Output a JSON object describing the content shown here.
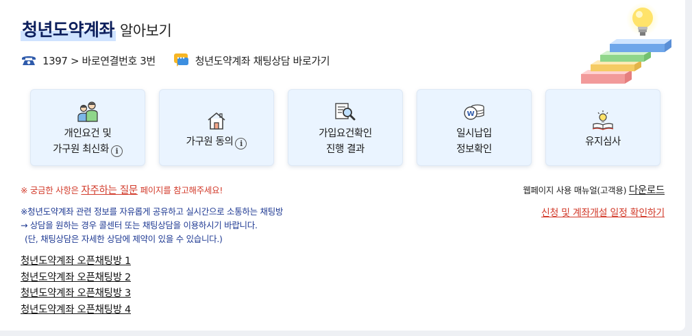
{
  "header": {
    "title_main": "청년도약계좌",
    "title_sub": "알아보기"
  },
  "contact": {
    "phone_text": "1397 > 바로연결번호 3번",
    "chat_text": "청년도약계좌 채팅상담 바로가기",
    "phone_icon": "phone-icon",
    "chat_icon": "chat-bubble-icon"
  },
  "cards": [
    {
      "line1": "개인요건 및",
      "line2": "가구원 최신화",
      "icon": "family-icon",
      "info": "i"
    },
    {
      "line1": "가구원 동의",
      "line2": "",
      "icon": "house-icon",
      "info": "i"
    },
    {
      "line1": "가입요건확인",
      "line2": "진행 결과",
      "icon": "document-search-icon",
      "info": ""
    },
    {
      "line1": "일시납입",
      "line2": "정보확인",
      "icon": "coins-icon",
      "info": ""
    },
    {
      "line1": "유지심사",
      "line2": "",
      "icon": "book-lightbulb-icon",
      "info": ""
    }
  ],
  "faq": {
    "prefix": "※ 궁금한 사항은 ",
    "link": "자주하는 질문",
    "suffix": " 페이지를 참고해주세요!"
  },
  "manual": {
    "text": "웹페이지 사용 매뉴얼(고객용) ",
    "link": "다운로드"
  },
  "schedule_link": "신청 및 계좌개설 일정 확인하기",
  "chat_info": {
    "line1": "※청년도약계좌 관련 정보를 자유롭게 공유하고 실시간으로 소통하는 채팅방",
    "line2": "→ 상담을 원하는 경우 콜센터 또는 채팅상담을 이용하시기 바랍니다.",
    "line3": "(단, 채팅상담은 자세한 상담에 제약이 있을 수 있습니다.)"
  },
  "open_chat_rooms": [
    "청년도약계좌 오픈채팅방 1",
    "청년도약계좌 오픈채팅방 2",
    "청년도약계좌 오픈채팅방 3",
    "청년도약계좌 오픈채팅방 4"
  ],
  "colors": {
    "title_navy": "#0d1f5c",
    "highlight_blue": "#cfe3ff",
    "card_bg": "#eaf4ff",
    "notice_red": "#d23a2a",
    "info_blue": "#1f3a93"
  }
}
